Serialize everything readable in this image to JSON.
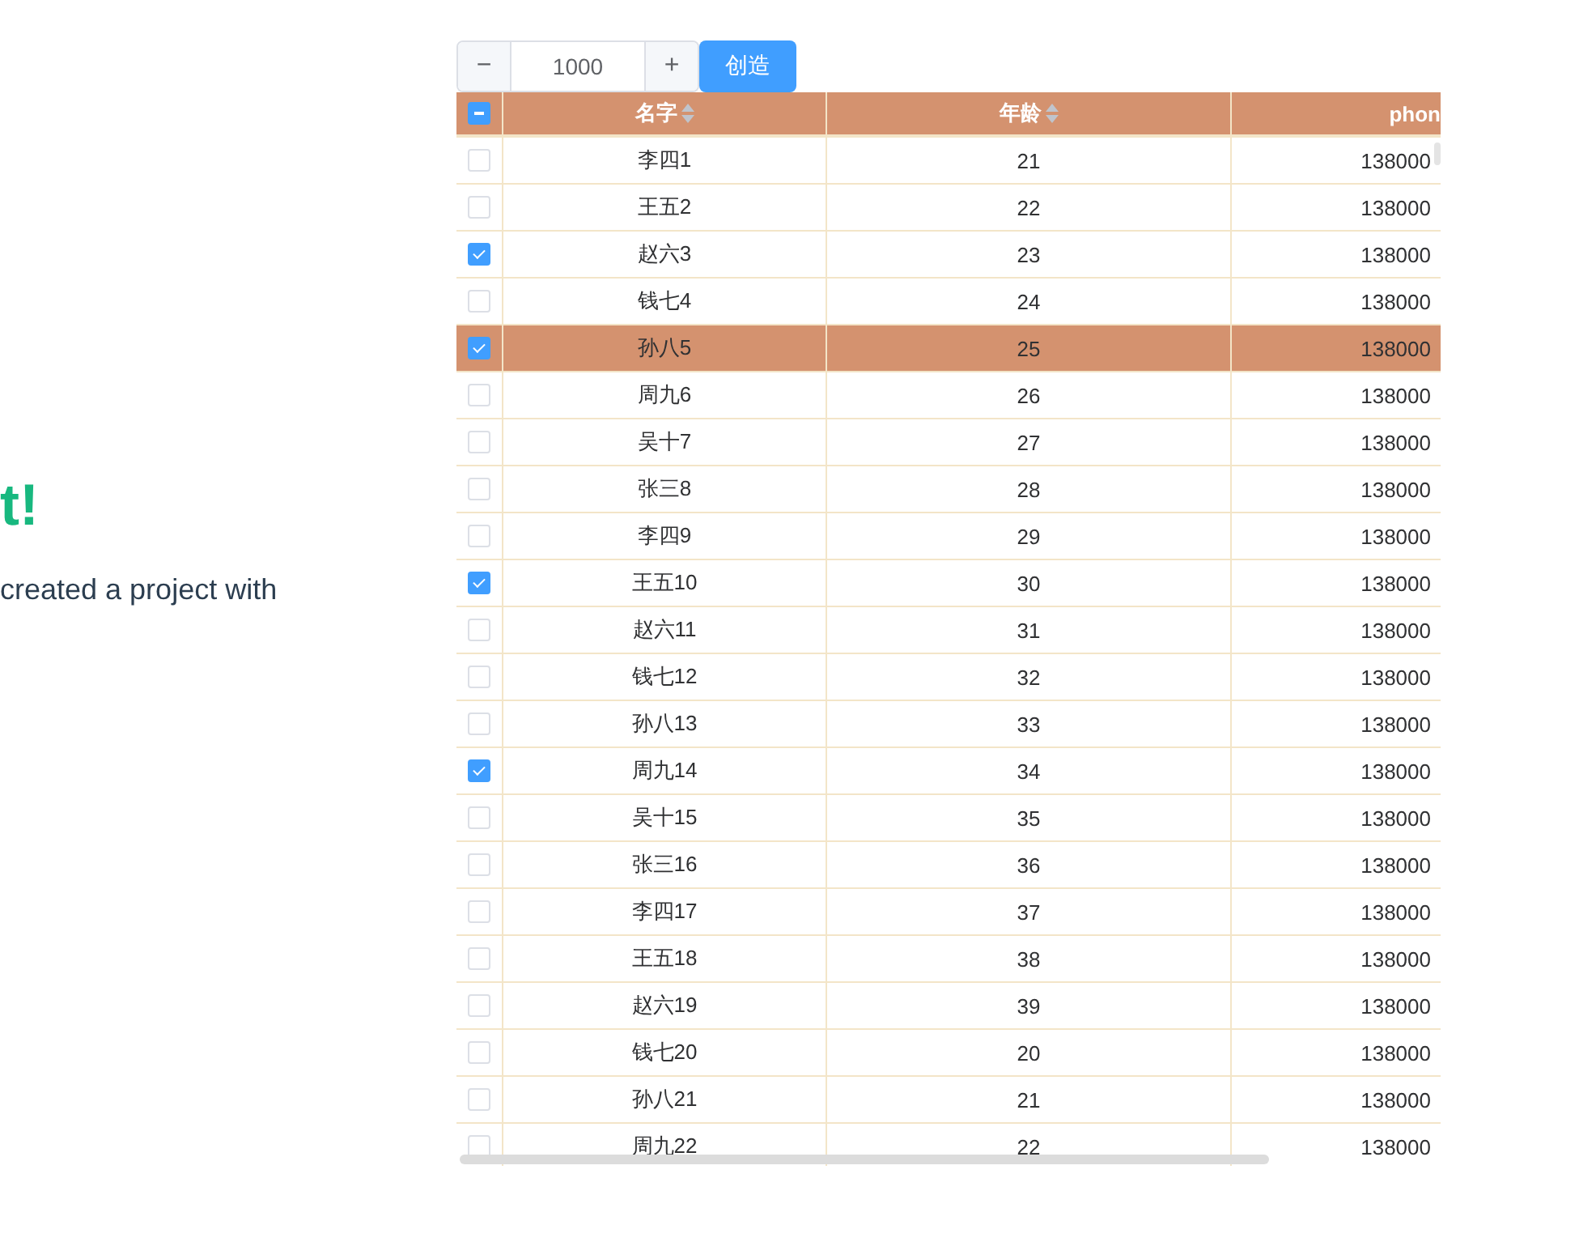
{
  "intro": {
    "heading": "t!",
    "text": "created a project with"
  },
  "toolbar": {
    "minus": "−",
    "value": "1000",
    "plus": "+",
    "create_button": "创造"
  },
  "table": {
    "select_all": {
      "indeterminate": true
    },
    "columns": [
      {
        "label": "名字",
        "sortable": true
      },
      {
        "label": "年龄",
        "sortable": true
      },
      {
        "label": "phon",
        "sortable": false
      }
    ],
    "rows": [
      {
        "name": "李四1",
        "age": "21",
        "phone": "138000",
        "checked": false,
        "selected": false
      },
      {
        "name": "王五2",
        "age": "22",
        "phone": "138000",
        "checked": false,
        "selected": false
      },
      {
        "name": "赵六3",
        "age": "23",
        "phone": "138000",
        "checked": true,
        "selected": false
      },
      {
        "name": "钱七4",
        "age": "24",
        "phone": "138000",
        "checked": false,
        "selected": false
      },
      {
        "name": "孙八5",
        "age": "25",
        "phone": "138000",
        "checked": true,
        "selected": true
      },
      {
        "name": "周九6",
        "age": "26",
        "phone": "138000",
        "checked": false,
        "selected": false
      },
      {
        "name": "吴十7",
        "age": "27",
        "phone": "138000",
        "checked": false,
        "selected": false
      },
      {
        "name": "张三8",
        "age": "28",
        "phone": "138000",
        "checked": false,
        "selected": false
      },
      {
        "name": "李四9",
        "age": "29",
        "phone": "138000",
        "checked": false,
        "selected": false
      },
      {
        "name": "王五10",
        "age": "30",
        "phone": "138000",
        "checked": true,
        "selected": false
      },
      {
        "name": "赵六11",
        "age": "31",
        "phone": "138000",
        "checked": false,
        "selected": false
      },
      {
        "name": "钱七12",
        "age": "32",
        "phone": "138000",
        "checked": false,
        "selected": false
      },
      {
        "name": "孙八13",
        "age": "33",
        "phone": "138000",
        "checked": false,
        "selected": false
      },
      {
        "name": "周九14",
        "age": "34",
        "phone": "138000",
        "checked": true,
        "selected": false
      },
      {
        "name": "吴十15",
        "age": "35",
        "phone": "138000",
        "checked": false,
        "selected": false
      },
      {
        "name": "张三16",
        "age": "36",
        "phone": "138000",
        "checked": false,
        "selected": false
      },
      {
        "name": "李四17",
        "age": "37",
        "phone": "138000",
        "checked": false,
        "selected": false
      },
      {
        "name": "王五18",
        "age": "38",
        "phone": "138000",
        "checked": false,
        "selected": false
      },
      {
        "name": "赵六19",
        "age": "39",
        "phone": "138000",
        "checked": false,
        "selected": false
      },
      {
        "name": "钱七20",
        "age": "20",
        "phone": "138000",
        "checked": false,
        "selected": false
      },
      {
        "name": "孙八21",
        "age": "21",
        "phone": "138000",
        "checked": false,
        "selected": false
      },
      {
        "name": "周九22",
        "age": "22",
        "phone": "138000",
        "checked": false,
        "selected": false
      }
    ]
  }
}
